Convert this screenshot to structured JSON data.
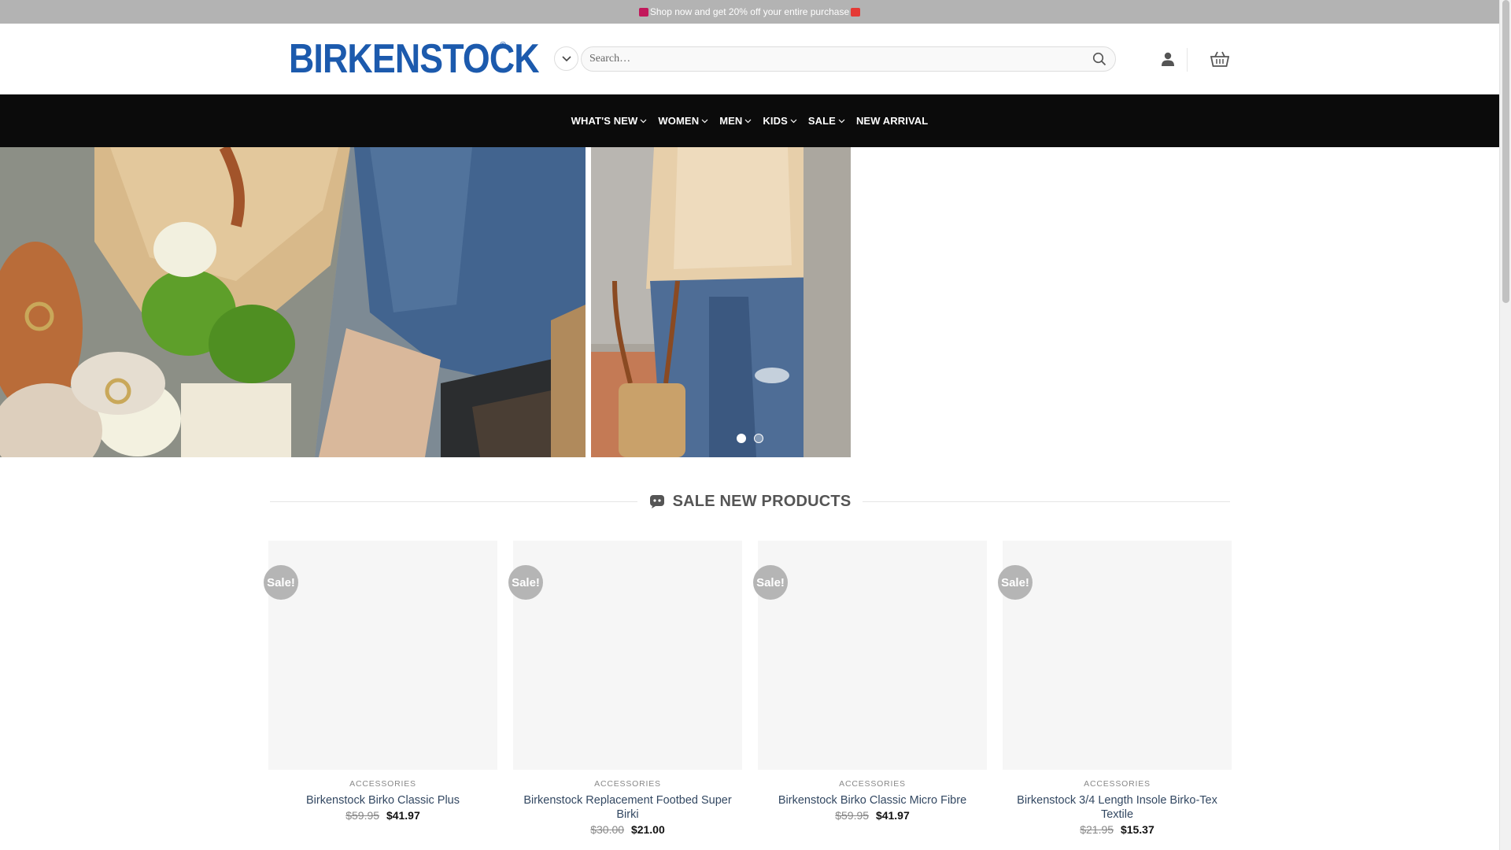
{
  "topbar": {
    "promo_text": "Shop now and get 20% off your entire purchase"
  },
  "header": {
    "logo_text": "BIRKENSTOCK",
    "logo_reg": "®",
    "search_placeholder": "Search…"
  },
  "nav": {
    "items": [
      {
        "label": "WHAT'S NEW",
        "has_dropdown": true
      },
      {
        "label": "WOMEN",
        "has_dropdown": true
      },
      {
        "label": "MEN",
        "has_dropdown": true
      },
      {
        "label": "KIDS",
        "has_dropdown": true
      },
      {
        "label": "SALE",
        "has_dropdown": true
      },
      {
        "label": "NEW ARRIVAL",
        "has_dropdown": false
      }
    ]
  },
  "hero": {
    "slide_count": 2,
    "active_slide": 1
  },
  "section": {
    "title": "SALE NEW PRODUCTS"
  },
  "products": [
    {
      "badge": "Sale!",
      "category": "ACCESSORIES",
      "name": "Birkenstock Birko Classic Plus",
      "old_price": "$59.95",
      "new_price": "$41.97"
    },
    {
      "badge": "Sale!",
      "category": "ACCESSORIES",
      "name": "Birkenstock Replacement Footbed Super Birki",
      "old_price": "$30.00",
      "new_price": "$21.00"
    },
    {
      "badge": "Sale!",
      "category": "ACCESSORIES",
      "name": "Birkenstock Birko Classic Micro Fibre",
      "old_price": "$59.95",
      "new_price": "$41.97"
    },
    {
      "badge": "Sale!",
      "category": "ACCESSORIES",
      "name": "Birkenstock 3/4 Length Insole Birko-Tex Textile",
      "old_price": "$21.95",
      "new_price": "$15.37"
    }
  ],
  "colors": {
    "brand_blue": "#1c5aad",
    "nav_bg": "#0b0b0b",
    "topbar_bg": "#b3b3b3",
    "sale_badge": "#b5b5b5",
    "link": "#334862"
  }
}
